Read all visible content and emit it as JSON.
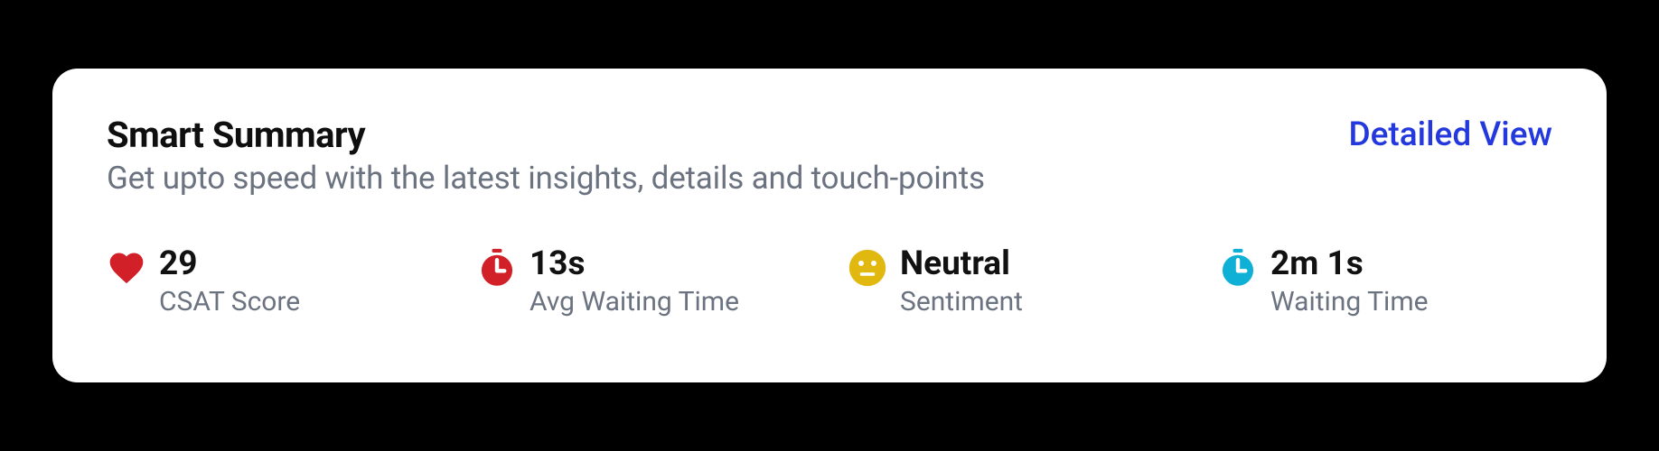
{
  "header": {
    "title": "Smart Summary",
    "subtitle": "Get upto speed with the latest insights, details and touch-points",
    "detailed_link_label": "Detailed View"
  },
  "stats": [
    {
      "icon": "heart-icon",
      "icon_color": "#d12027",
      "value": "29",
      "label": "CSAT Score"
    },
    {
      "icon": "stopwatch-icon",
      "icon_color": "#d12027",
      "value": "13s",
      "label": "Avg Waiting Time"
    },
    {
      "icon": "neutral-face-icon",
      "icon_color": "#e1b80f",
      "value": "Neutral",
      "label": "Sentiment"
    },
    {
      "icon": "stopwatch-icon",
      "icon_color": "#0eb0d6",
      "value": "2m 1s",
      "label": "Waiting Time"
    }
  ]
}
